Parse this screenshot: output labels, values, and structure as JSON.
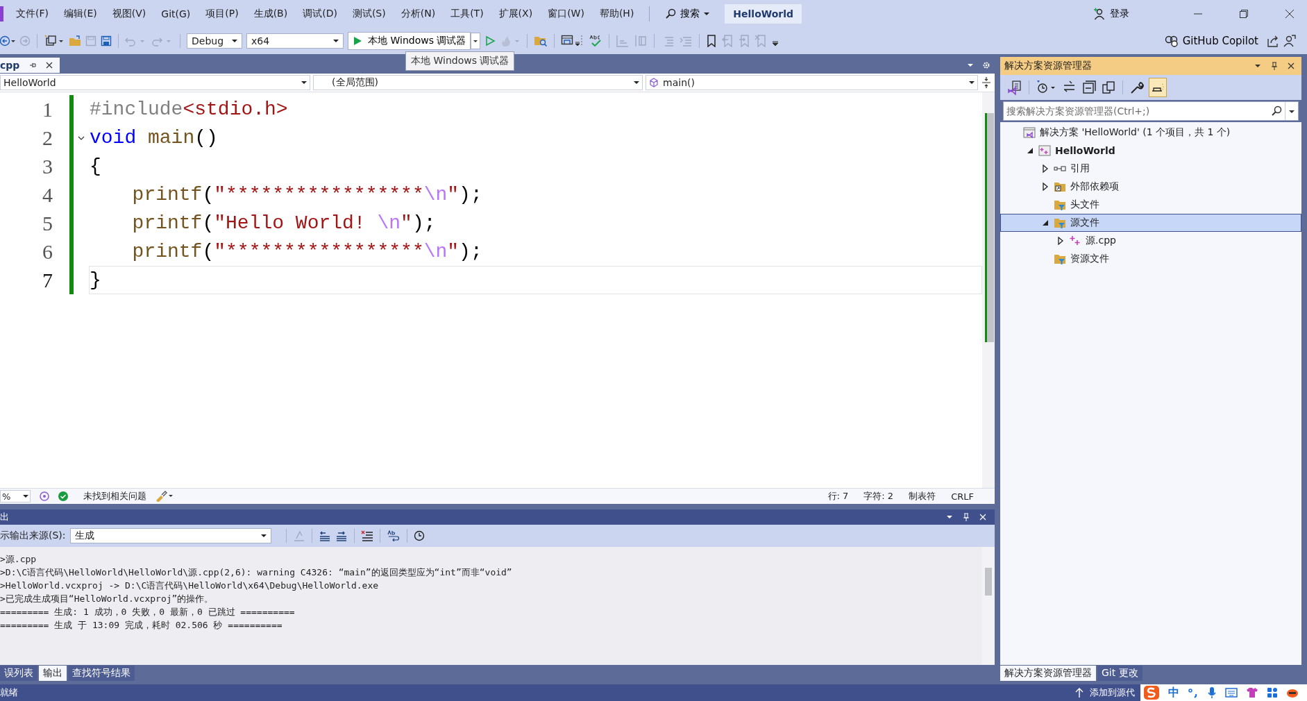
{
  "menu": [
    "文件(F)",
    "编辑(E)",
    "视图(V)",
    "Git(G)",
    "项目(P)",
    "生成(B)",
    "调试(D)",
    "测试(S)",
    "分析(N)",
    "工具(T)",
    "扩展(X)",
    "窗口(W)",
    "帮助(H)"
  ],
  "search": "搜索",
  "title": "HelloWorld",
  "login": "登录",
  "toolbar": {
    "configuration": "Debug",
    "platform": "x64",
    "run": "本地 Windows 调试器",
    "tooltip": "本地 Windows 调试器",
    "copilot": "GitHub Copilot"
  },
  "editor": {
    "tab": "cpp",
    "project": "HelloWorld",
    "scope": "(全局范围)",
    "member": "main()",
    "lines": [
      {
        "number": "1",
        "selected": false,
        "fold": false,
        "indented": false,
        "tokens": [
          {
            "kind": "preprocessor",
            "text": "#include"
          },
          {
            "kind": "string",
            "text": "<stdio.h>"
          }
        ]
      },
      {
        "number": "2",
        "selected": false,
        "fold": true,
        "indented": false,
        "tokens": [
          {
            "kind": "keyword",
            "text": "void"
          },
          {
            "kind": "function",
            "text": "main",
            "space_before": true
          },
          {
            "kind": "plain",
            "text": "()"
          }
        ]
      },
      {
        "number": "3",
        "selected": false,
        "fold": false,
        "indented": false,
        "tokens": [
          {
            "kind": "plain",
            "text": "{"
          }
        ]
      },
      {
        "number": "4",
        "selected": false,
        "fold": false,
        "indented": true,
        "tokens": [
          {
            "kind": "function",
            "text": "printf"
          },
          {
            "kind": "plain",
            "text": "("
          },
          {
            "kind": "string",
            "text": "\"*****************"
          },
          {
            "kind": "escape",
            "text": "\\n"
          },
          {
            "kind": "string",
            "text": "\""
          },
          {
            "kind": "plain",
            "text": ");"
          }
        ]
      },
      {
        "number": "5",
        "selected": false,
        "fold": false,
        "indented": true,
        "tokens": [
          {
            "kind": "function",
            "text": "printf"
          },
          {
            "kind": "plain",
            "text": "("
          },
          {
            "kind": "string",
            "text": "\"Hello World! "
          },
          {
            "kind": "escape",
            "text": "\\n"
          },
          {
            "kind": "string",
            "text": "\""
          },
          {
            "kind": "plain",
            "text": ");"
          }
        ]
      },
      {
        "number": "6",
        "selected": false,
        "fold": false,
        "indented": true,
        "tokens": [
          {
            "kind": "function",
            "text": "printf"
          },
          {
            "kind": "plain",
            "text": "("
          },
          {
            "kind": "string",
            "text": "\"*****************"
          },
          {
            "kind": "escape",
            "text": "\\n"
          },
          {
            "kind": "string",
            "text": "\""
          },
          {
            "kind": "plain",
            "text": ");"
          }
        ]
      },
      {
        "number": "7",
        "selected": true,
        "fold": false,
        "indented": false,
        "tokens": [
          {
            "kind": "plain",
            "text": "}"
          }
        ]
      }
    ],
    "status": {
      "zoom": "%",
      "issues": "未找到相关问题",
      "line": "行: 7",
      "column": "字符: 2",
      "indent": "制表符",
      "eol": "CRLF"
    }
  },
  "output": {
    "title": "出",
    "source_label": "示输出来源(S):",
    "source": "生成",
    "lines": [
      ">源.cpp",
      ">D:\\C语言代码\\HelloWorld\\HelloWorld\\源.cpp(2,6): warning C4326: “main”的返回类型应为“int”而非“void”",
      ">HelloWorld.vcxproj -> D:\\C语言代码\\HelloWorld\\x64\\Debug\\HelloWorld.exe",
      ">已完成生成项目“HelloWorld.vcxproj”的操作。",
      "========= 生成: 1 成功，0 失败，0 最新，0 已跳过 ==========",
      "========= 生成 于 13:09 完成，耗时 02.506 秒 =========="
    ],
    "tabs": [
      {
        "label": "误列表",
        "selected": false
      },
      {
        "label": "输出",
        "selected": true
      },
      {
        "label": "查找符号结果",
        "selected": false
      }
    ]
  },
  "solution_explorer": {
    "title": "解决方案资源管理器",
    "search_placeholder": "搜索解决方案资源管理器(Ctrl+;)",
    "tree": [
      {
        "label": "解决方案 'HelloWorld' (1 个项目，共 1 个)",
        "kind": "solution",
        "selected": false,
        "children": [
          {
            "label": "HelloWorld",
            "kind": "project",
            "expanded": true,
            "selected": false,
            "children": [
              {
                "label": "引用",
                "kind": "references",
                "expanded": false,
                "selected": false
              },
              {
                "label": "外部依赖项",
                "kind": "external",
                "expanded": false,
                "selected": false
              },
              {
                "label": "头文件",
                "kind": "filter",
                "selected": false
              },
              {
                "label": "源文件",
                "kind": "filter",
                "expanded": true,
                "selected": true,
                "children": [
                  {
                    "label": "源.cpp",
                    "kind": "cpp",
                    "expanded": false,
                    "selected": false
                  }
                ]
              },
              {
                "label": "资源文件",
                "kind": "filter",
                "selected": false
              }
            ]
          }
        ]
      }
    ],
    "tabs": [
      {
        "label": "解决方案资源管理器",
        "selected": true
      },
      {
        "label": "Git 更改",
        "selected": false
      }
    ]
  },
  "status_bar": {
    "state": "就绪",
    "source_control": "添加到源代",
    "ime_mode": "中"
  }
}
